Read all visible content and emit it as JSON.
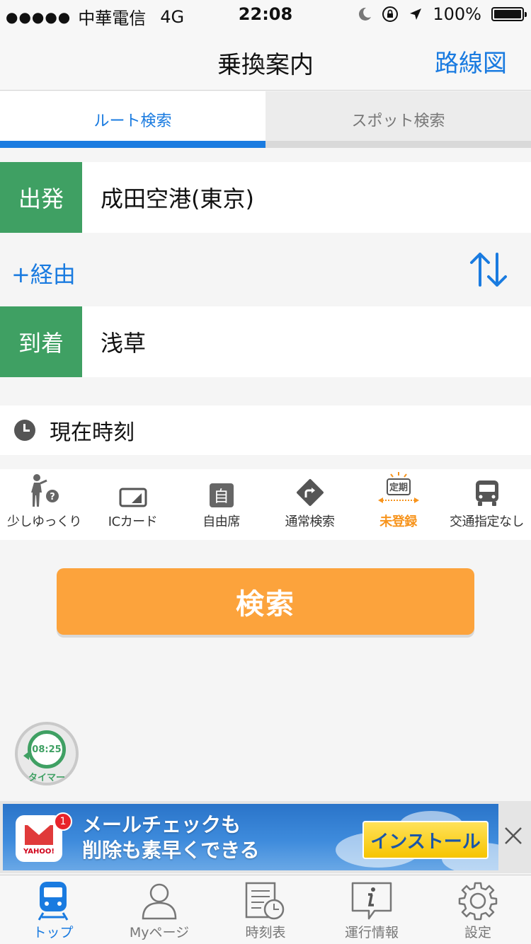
{
  "status_bar": {
    "signal": "●●●●●",
    "carrier": "中華電信",
    "network": "4G",
    "time": "22:08",
    "battery": "100%",
    "battery_level": 1.0
  },
  "nav": {
    "title": "乗換案内",
    "right_button": "路線図"
  },
  "tabs": [
    {
      "label": "ルート検索",
      "active": true
    },
    {
      "label": "スポット検索",
      "active": false
    }
  ],
  "departure": {
    "badge": "出発",
    "value": "成田空港(東京)"
  },
  "via": {
    "label": "+経由"
  },
  "arrival": {
    "badge": "到着",
    "value": "浅草"
  },
  "time_setting": {
    "label": "現在時刻"
  },
  "options": [
    {
      "label": "少しゆっくり",
      "icon": "walking-person-icon"
    },
    {
      "label": "ICカード",
      "icon": "ic-card-icon"
    },
    {
      "label": "自由席",
      "icon": "seat-icon",
      "icon_text": "自"
    },
    {
      "label": "通常検索",
      "icon": "route-turn-icon"
    },
    {
      "label": "未登録",
      "icon": "commuter-pass-icon",
      "icon_text": "定期",
      "highlight": true
    },
    {
      "label": "交通指定なし",
      "icon": "bus-icon"
    }
  ],
  "search_button": {
    "label": "検索"
  },
  "timer": {
    "time": "08:25",
    "label": "タイマー"
  },
  "ad": {
    "line1": "メールチェックも",
    "line2": "削除も素早くできる",
    "button": "インストール",
    "badge": "1",
    "brand": "YAHOO!"
  },
  "tabbar": [
    {
      "label": "トップ",
      "icon": "train-icon",
      "active": true
    },
    {
      "label": "Myページ",
      "icon": "person-icon",
      "active": false
    },
    {
      "label": "時刻表",
      "icon": "timetable-icon",
      "active": false
    },
    {
      "label": "運行情報",
      "icon": "info-icon",
      "active": false
    },
    {
      "label": "設定",
      "icon": "gear-icon",
      "active": false
    }
  ],
  "colors": {
    "accent": "#1a7be0",
    "badge_green": "#3fa063",
    "search_orange": "#fca33c",
    "highlight_orange": "#f7941d"
  }
}
